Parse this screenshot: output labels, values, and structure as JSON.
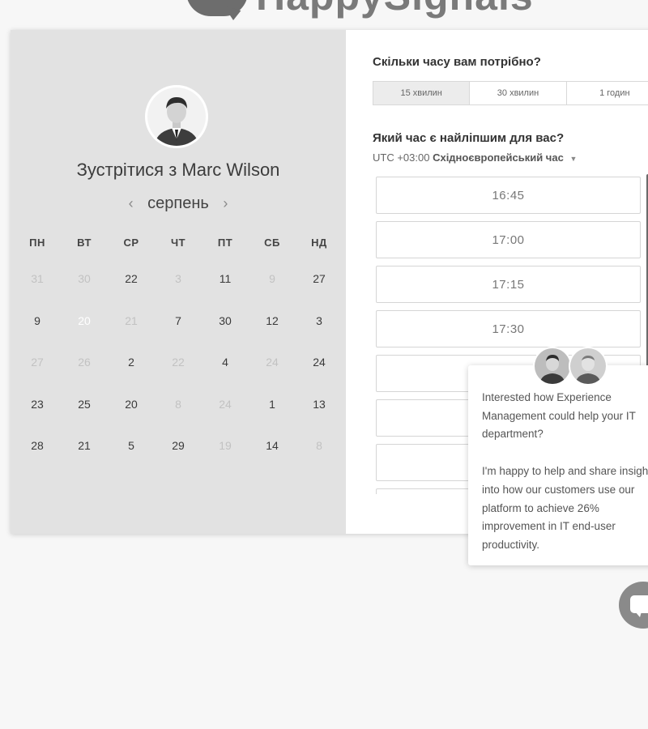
{
  "logo": {
    "text": "HappySignals"
  },
  "profile": {
    "meet_text": "Зустрітися з Marc Wilson"
  },
  "calendar": {
    "month": "серпень",
    "prev_icon": "chevron-left-icon",
    "next_icon": "chevron-right-icon",
    "weekdays": [
      "ПН",
      "ВТ",
      "СР",
      "ЧТ",
      "ПТ",
      "СБ",
      "НД"
    ],
    "weeks": [
      [
        {
          "d": "31",
          "m": true
        },
        {
          "d": "30",
          "m": true
        },
        {
          "d": "22",
          "m": false
        },
        {
          "d": "3",
          "m": true
        },
        {
          "d": "11",
          "m": false
        },
        {
          "d": "9",
          "m": true
        },
        {
          "d": "27",
          "m": false
        }
      ],
      [
        {
          "d": "9",
          "m": false
        },
        {
          "d": "20",
          "m": false,
          "sel": true
        },
        {
          "d": "21",
          "m": true
        },
        {
          "d": "7",
          "m": false
        },
        {
          "d": "30",
          "m": false
        },
        {
          "d": "12",
          "m": false
        },
        {
          "d": "3",
          "m": false
        }
      ],
      [
        {
          "d": "27",
          "m": true
        },
        {
          "d": "26",
          "m": true
        },
        {
          "d": "2",
          "m": false
        },
        {
          "d": "22",
          "m": true
        },
        {
          "d": "4",
          "m": false
        },
        {
          "d": "24",
          "m": true
        },
        {
          "d": "24",
          "m": false
        }
      ],
      [
        {
          "d": "23",
          "m": false
        },
        {
          "d": "25",
          "m": false
        },
        {
          "d": "20",
          "m": false
        },
        {
          "d": "8",
          "m": true
        },
        {
          "d": "24",
          "m": true
        },
        {
          "d": "1",
          "m": false
        },
        {
          "d": "13",
          "m": false
        }
      ],
      [
        {
          "d": "28",
          "m": false
        },
        {
          "d": "21",
          "m": false
        },
        {
          "d": "5",
          "m": false
        },
        {
          "d": "29",
          "m": false
        },
        {
          "d": "19",
          "m": true
        },
        {
          "d": "14",
          "m": false
        },
        {
          "d": "8",
          "m": true
        }
      ]
    ]
  },
  "duration": {
    "question": "Скільки часу вам потрібно?",
    "options": [
      "15 хвилин",
      "30 хвилин",
      "1 годин"
    ],
    "selected_index": 0
  },
  "time": {
    "question": "Який час є найліпшим для вас?",
    "tz_offset": "UTC +03:00",
    "tz_name": "Східноєвропейський час",
    "tz_caret_icon": "caret-down-icon",
    "slots": [
      "16:45",
      "17:00",
      "17:15",
      "17:30",
      "",
      "",
      "",
      ""
    ]
  },
  "chat": {
    "paragraph1": "Interested how Experience Management could help your IT department?",
    "paragraph2": "I'm happy to help and share insight into how our customers use our platform to achieve 26% improvement in IT end-user productivity.",
    "button_icon": "chat-bubble-icon"
  },
  "colors": {
    "left_panel": "#e2e2e2",
    "selected_day": "#424242",
    "muted_day": "#c2c2c2",
    "chat_button": "#8a8a8a"
  }
}
